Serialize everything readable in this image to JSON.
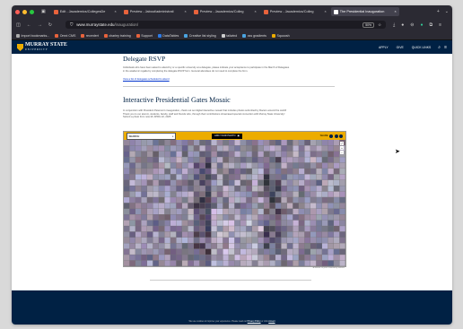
{
  "browser": {
    "tabs": [
      {
        "title": "Edit - Jacademics/CollegesDe",
        "color": "#e8633c",
        "active": false
      },
      {
        "title": "Preview - Jabout/administrati",
        "color": "#e8633c",
        "active": false
      },
      {
        "title": "Preview - Jacademics/Colleg",
        "color": "#e8633c",
        "active": false
      },
      {
        "title": "Preview - Jacademics/Colleg",
        "color": "#e8633c",
        "active": false
      },
      {
        "title": "The Presidential Inauguration",
        "color": "#ffffff",
        "active": true
      }
    ],
    "url_host": "www.murraystate.edu",
    "url_path": "/inauguration/",
    "zoom": "50%",
    "bookmarks": [
      {
        "label": "Import bookmarks...",
        "color": "#aaaaaa"
      },
      {
        "label": "Omni CMS",
        "color": "#e8633c"
      },
      {
        "label": "recenlert",
        "color": "#e8633c"
      },
      {
        "label": "charley training",
        "color": "#e8633c"
      },
      {
        "label": "Support",
        "color": "#e8633c"
      },
      {
        "label": "DataTables",
        "color": "#2d7be5"
      },
      {
        "label": "Creative list styling",
        "color": "#4aa3df"
      },
      {
        "label": "tailwind",
        "color": "#cccccc"
      },
      {
        "label": "css gradients",
        "color": "#4aa3df"
      },
      {
        "label": "Squoosh",
        "color": "#ecac00"
      }
    ]
  },
  "site": {
    "logo_main": "MURRAY STATE",
    "logo_sub": "UNIVERSITY",
    "nav": [
      "APPLY",
      "GIVE",
      "QUICK LINKS"
    ]
  },
  "page": {
    "rsvp_title": "Delegate RSVP",
    "rsvp_text_1": "Individuals who have been asked to attend by or a specific university at a delegate, please indicate your acceptance to participate in the March of Delegates",
    "rsvp_text_2": "in the academic regalia by completing the delegate RSVP form. General attendees do not need to complete the form.",
    "delegates_link": "View a list of delegates scheduled to attend",
    "mosaic_title": "Interactive Presidential Gates Mosaic",
    "mosaic_text_1": "In conjunction with President Peterson's inauguration, check out our digital interactive mosaic that includes photos submitted by Racers around the world!",
    "mosaic_text_2": "Thank you to our alumni, students, faculty, staff and friends who, through their contributions showcased special connection with Murray State University!",
    "mosaic_text_3": "Submit a photo from now till: APRIL 22, 2025",
    "search_label": "SEARCH",
    "add_photo": "ADD YOUR PHOTO",
    "share_label": "SHARE",
    "caption": "A Mosaic of your community website",
    "footnote": "Event details are subject to change and will be updated on this web page as necessary.",
    "cookie_text": "We use cookies to improve your experience. Please read our",
    "cookie_link": "Privacy Policy",
    "cookie_tail": "or click",
    "cookie_accept": "Accept"
  }
}
